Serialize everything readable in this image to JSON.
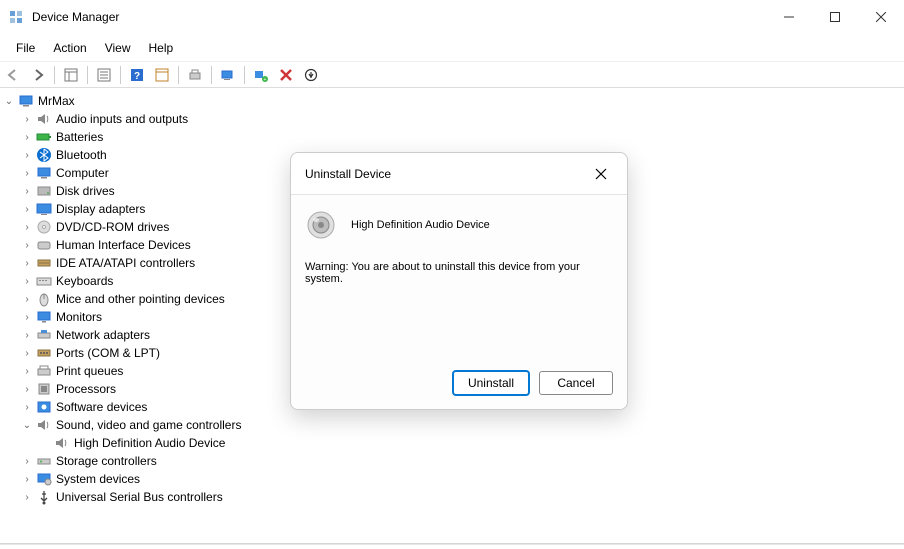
{
  "window": {
    "title": "Device Manager"
  },
  "menu": {
    "file": "File",
    "action": "Action",
    "view": "View",
    "help": "Help"
  },
  "tree": {
    "root": "MrMax",
    "categories": [
      "Audio inputs and outputs",
      "Batteries",
      "Bluetooth",
      "Computer",
      "Disk drives",
      "Display adapters",
      "DVD/CD-ROM drives",
      "Human Interface Devices",
      "IDE ATA/ATAPI controllers",
      "Keyboards",
      "Mice and other pointing devices",
      "Monitors",
      "Network adapters",
      "Ports (COM & LPT)",
      "Print queues",
      "Processors",
      "Software devices",
      "Sound, video and game controllers",
      "Storage controllers",
      "System devices",
      "Universal Serial Bus controllers"
    ],
    "expanded_child": "High Definition Audio Device"
  },
  "dialog": {
    "title": "Uninstall Device",
    "device_name": "High Definition Audio Device",
    "warning": "Warning: You are about to uninstall this device from your system.",
    "uninstall": "Uninstall",
    "cancel": "Cancel"
  }
}
